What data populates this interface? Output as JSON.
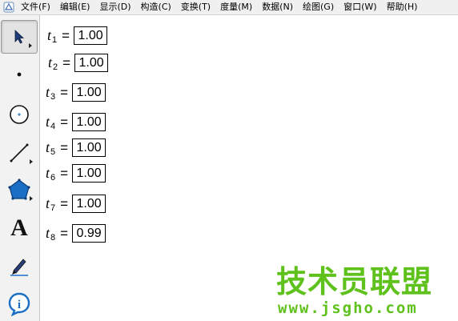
{
  "menu": {
    "items": [
      "文件(F)",
      "编辑(E)",
      "显示(D)",
      "构造(C)",
      "变换(T)",
      "度量(M)",
      "数据(N)",
      "绘图(G)",
      "窗口(W)",
      "帮助(H)"
    ]
  },
  "toolbox": {
    "tools": [
      {
        "name": "arrow-tool",
        "icon": "arrow-icon",
        "selected": true
      },
      {
        "name": "point-tool",
        "icon": "point-icon"
      },
      {
        "name": "compass-tool",
        "icon": "compass-icon"
      },
      {
        "name": "straightedge-tool",
        "icon": "straightedge-icon"
      },
      {
        "name": "polygon-tool",
        "icon": "polygon-icon"
      },
      {
        "name": "text-tool",
        "icon": "text-icon",
        "glyph": "A"
      },
      {
        "name": "marker-tool",
        "icon": "marker-icon"
      },
      {
        "name": "info-tool",
        "icon": "info-icon",
        "glyph": "i"
      }
    ]
  },
  "parameters": [
    {
      "var": "t",
      "sub": "1",
      "eq": "=",
      "value": "1.00"
    },
    {
      "var": "t",
      "sub": "2",
      "eq": "=",
      "value": "1.00"
    },
    {
      "var": "t",
      "sub": "3",
      "eq": "=",
      "value": "1.00"
    },
    {
      "var": "t",
      "sub": "4",
      "eq": "=",
      "value": "1.00"
    },
    {
      "var": "t",
      "sub": "5",
      "eq": "=",
      "value": "1.00"
    },
    {
      "var": "t",
      "sub": "6",
      "eq": "=",
      "value": "1.00"
    },
    {
      "var": "t",
      "sub": "7",
      "eq": "=",
      "value": "1.00"
    },
    {
      "var": "t",
      "sub": "8",
      "eq": "=",
      "value": "0.99"
    }
  ],
  "watermark": {
    "title": "技术员联盟",
    "url": "www.jsgho.com"
  },
  "colors": {
    "watermark": "#5fc21c",
    "polygon": "#1a6fc4",
    "toolbox_bg": "#f2f2f2"
  }
}
